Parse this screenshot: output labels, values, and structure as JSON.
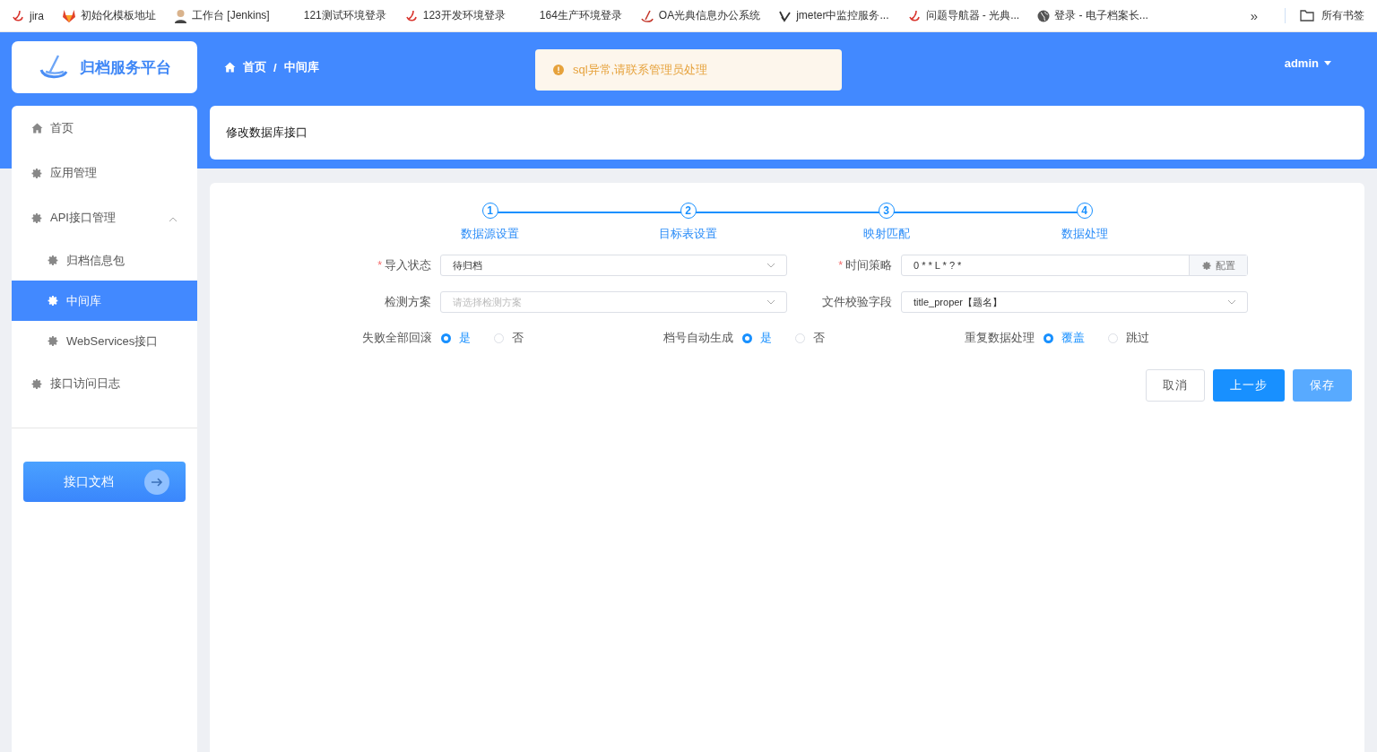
{
  "bookmarks": [
    {
      "label": "jira"
    },
    {
      "label": "初始化模板地址"
    },
    {
      "label": "工作台 [Jenkins]"
    },
    {
      "label": "121测试环境登录"
    },
    {
      "label": "123开发环境登录"
    },
    {
      "label": "164生产环境登录"
    },
    {
      "label": "OA光典信息办公系统"
    },
    {
      "label": "jmeter中监控服务..."
    },
    {
      "label": "问题导航器 - 光典..."
    },
    {
      "label": "登录 - 电子档案长..."
    }
  ],
  "bookmarks_more": "»",
  "all_bookmarks": "所有书签",
  "logo": {
    "title": "归档服务平台"
  },
  "breadcrumb": [
    "首页",
    "中间库"
  ],
  "breadcrumb_separator": "/",
  "required_mark": "*",
  "alert": {
    "message": "sql异常,请联系管理员处理"
  },
  "user": {
    "name": "admin"
  },
  "sidebar": {
    "items": [
      {
        "label": "首页",
        "selected": false
      },
      {
        "label": "应用管理",
        "selected": false
      },
      {
        "label": "API接口管理",
        "selected": false,
        "expanded": true,
        "children": [
          {
            "label": "归档信息包",
            "selected": false
          },
          {
            "label": "中间库",
            "selected": true
          },
          {
            "label": "WebServices接口",
            "selected": false
          }
        ]
      },
      {
        "label": "接口访问日志",
        "selected": false
      }
    ],
    "doc_button": "接口文档"
  },
  "page_title": "修改数据库接口",
  "steps": [
    {
      "number": "1",
      "label": "数据源设置"
    },
    {
      "number": "2",
      "label": "目标表设置"
    },
    {
      "number": "3",
      "label": "映射匹配"
    },
    {
      "number": "4",
      "label": "数据处理"
    }
  ],
  "fields": [
    {
      "kind": "select",
      "label": "导入状态",
      "required": true,
      "value": "待归档"
    },
    {
      "kind": "addon",
      "label": "时间策略",
      "required": true,
      "value": "0 * * L * ? *",
      "addon": "配置"
    },
    {
      "kind": "select",
      "label": "检测方案",
      "required": false,
      "placeholder": "请选择检测方案"
    },
    {
      "kind": "select",
      "label": "文件校验字段",
      "required": false,
      "value": "title_proper【题名】"
    }
  ],
  "radio_groups": [
    {
      "label": "失败全部回滚",
      "options": [
        {
          "label": "是",
          "selected": true
        },
        {
          "label": "否",
          "selected": false
        }
      ]
    },
    {
      "label": "档号自动生成",
      "options": [
        {
          "label": "是",
          "selected": true
        },
        {
          "label": "否",
          "selected": false
        }
      ]
    },
    {
      "label": "重复数据处理",
      "options": [
        {
          "label": "覆盖",
          "selected": true
        },
        {
          "label": "跳过",
          "selected": false
        }
      ]
    }
  ],
  "buttons": [
    {
      "kind": "default",
      "label": "取消"
    },
    {
      "kind": "primary",
      "label": "上一步"
    },
    {
      "kind": "light",
      "label": "保存"
    }
  ]
}
